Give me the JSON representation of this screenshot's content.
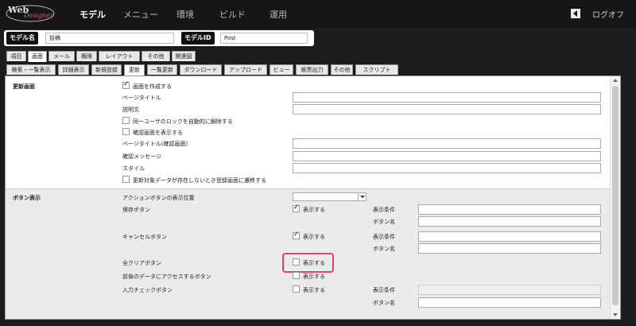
{
  "nav": {
    "logo_text": "Web Designer",
    "items": [
      "モデル",
      "メニュー",
      "環境",
      "ビルド",
      "運用"
    ],
    "logoff": "ログオフ"
  },
  "model": {
    "name_label": "モデル名",
    "name_value": "投稿",
    "id_label": "モデルID",
    "id_value": "Post"
  },
  "tabs_top": [
    "項目",
    "画面",
    "メール",
    "権限",
    "レイアウト",
    "その他",
    "関連図"
  ],
  "tabs_sub": [
    "検索・一覧表示",
    "詳細表示",
    "新規登録",
    "更新",
    "一覧更新",
    "ダウンロード",
    "アップロード",
    "ビュー",
    "帳票出力",
    "その他",
    "スクリプト"
  ],
  "update_section": {
    "title": "更新画面",
    "create_screen": "画面を作成する",
    "page_title": "ページタイトル",
    "description": "説明文",
    "auto_unlock": "同一ユーザのロックを自動的に解除する",
    "show_confirm": "確認画面を表示する",
    "confirm_title": "ページタイトル(確認画面)",
    "confirm_message": "確認メッセージ",
    "style": "スタイル",
    "redirect": "更新対象データが存在しないとき登録画面に遷移する"
  },
  "button_section": {
    "title": "ボタン表示",
    "action_position": "アクションボタンの表示位置",
    "save_button": "保存ボタン",
    "cancel_button": "キャンセルボタン",
    "clear_button": "全クリアボタン",
    "access_button": "前後のデータにアクセスするボタン",
    "input_check_button": "入力チェックボタン",
    "show": "表示する",
    "condition": "表示条件",
    "button_name": "ボタン名"
  }
}
